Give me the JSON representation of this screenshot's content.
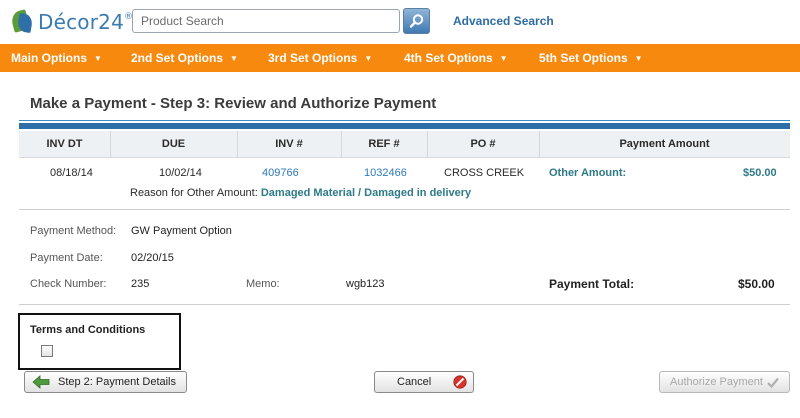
{
  "header": {
    "logo_text": "Décor24",
    "logo_reg": "®",
    "search_placeholder": "Product Search",
    "advanced_search": "Advanced Search"
  },
  "nav": {
    "items": [
      {
        "label": "Main Options"
      },
      {
        "label": "2nd Set Options"
      },
      {
        "label": "3rd Set Options"
      },
      {
        "label": "4th Set Options"
      },
      {
        "label": "5th Set Options"
      }
    ],
    "caret": "▼"
  },
  "page": {
    "title": "Make a Payment - Step 3: Review and Authorize Payment"
  },
  "table": {
    "headers": [
      "INV DT",
      "DUE",
      "INV #",
      "REF #",
      "PO #",
      "Payment Amount"
    ],
    "row": {
      "inv_dt": "08/18/14",
      "due": "10/02/14",
      "inv_no": "409766",
      "ref_no": "1032466",
      "po_no": "CROSS CREEK",
      "amount_label": "Other Amount:",
      "amount_value": "$50.00"
    },
    "reason_label": "Reason for Other Amount:",
    "reason_value": "Damaged Material / Damaged in delivery"
  },
  "payment": {
    "method_label": "Payment Method:",
    "method_value": "GW Payment Option",
    "date_label": "Payment Date:",
    "date_value": "02/20/15",
    "check_label": "Check Number:",
    "check_value": "235",
    "memo_label": "Memo:",
    "memo_value": "wgb123",
    "total_label": "Payment Total:",
    "total_value": "$50.00"
  },
  "terms": {
    "title": "Terms and Conditions",
    "checked": false
  },
  "buttons": {
    "back": "Step 2: Payment Details",
    "cancel": "Cancel",
    "authorize": "Authorize Payment"
  },
  "colors": {
    "nav_bg": "#f7890f",
    "title_rule": "#2f6fa8",
    "link": "#2d7ab8",
    "teal": "#2e7a87"
  }
}
